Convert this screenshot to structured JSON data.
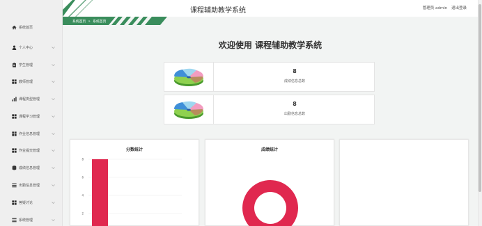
{
  "header": {
    "title": "课程辅助教学系统",
    "user_label": "管理员 admin",
    "logout_label": "退出登录"
  },
  "breadcrumb": {
    "home": "系统首页",
    "separator": "»",
    "current": "系统首页"
  },
  "sidebar": {
    "items": [
      {
        "label": "系统首页",
        "icon": "home-icon"
      },
      {
        "label": "个人中心",
        "icon": "user-icon"
      },
      {
        "label": "学生管理",
        "icon": "clipboard-icon"
      },
      {
        "label": "教师管理",
        "icon": "grid-icon"
      },
      {
        "label": "课程类型管理",
        "icon": "bar-chart-icon"
      },
      {
        "label": "课程学习管理",
        "icon": "grid-icon"
      },
      {
        "label": "作业信息管理",
        "icon": "grid-icon"
      },
      {
        "label": "作业提交管理",
        "icon": "grid-icon"
      },
      {
        "label": "成绩信息管理",
        "icon": "database-icon"
      },
      {
        "label": "出勤信息管理",
        "icon": "list-icon"
      },
      {
        "label": "答疑讨论",
        "icon": "grid-icon"
      },
      {
        "label": "系统管理",
        "icon": "list-icon"
      }
    ]
  },
  "welcome": "欢迎使用 课程辅助教学系统",
  "stats": [
    {
      "value": "8",
      "caption": "成绩信息总数"
    },
    {
      "value": "8",
      "caption": "出勤信息总数"
    }
  ],
  "panels": {
    "score_title": "分数统计",
    "grade_title": "成绩统计"
  },
  "chart_data": [
    {
      "type": "bar",
      "title": "分数统计",
      "categories": [
        ""
      ],
      "values": [
        8
      ],
      "y_ticks": [
        2,
        4,
        6,
        8
      ],
      "color": "#e0284f"
    },
    {
      "type": "pie",
      "title": "成绩统计",
      "values": [
        1
      ],
      "donut": true,
      "color": "#e0284f"
    }
  ],
  "colors": {
    "accent_green": "#3a8d5c",
    "bar": "#e0284f"
  }
}
